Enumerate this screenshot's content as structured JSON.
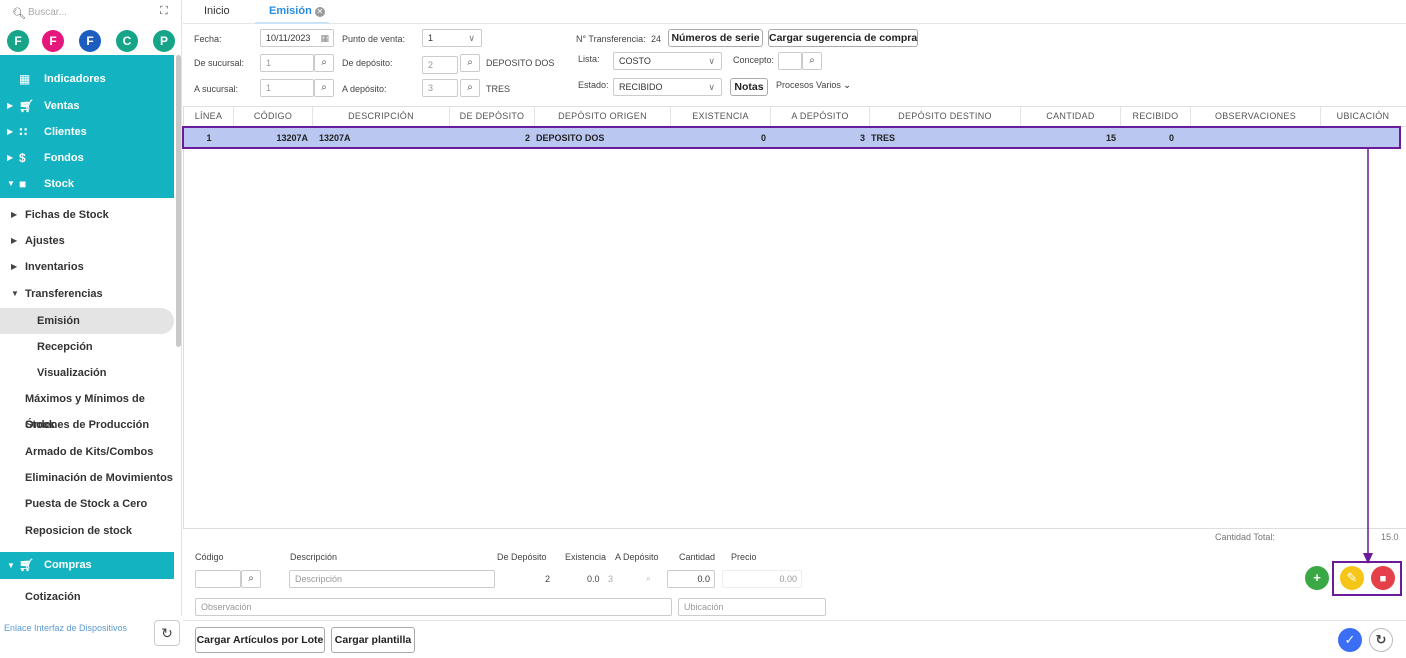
{
  "sidebar": {
    "search_placeholder": "Buscar...",
    "favorites": [
      {
        "letter": "F",
        "color": "#17a589"
      },
      {
        "letter": "F",
        "color": "#e5177d"
      },
      {
        "letter": "F",
        "color": "#1c5dbf"
      },
      {
        "letter": "C",
        "color": "#17a589"
      },
      {
        "letter": "P",
        "color": "#17a589"
      }
    ],
    "items": {
      "indicadores": "Indicadores",
      "ventas": "Ventas",
      "clientes": "Clientes",
      "fondos": "Fondos",
      "stock": "Stock",
      "fichas": "Fichas de Stock",
      "ajustes": "Ajustes",
      "inventarios": "Inventarios",
      "transferencias": "Transferencias",
      "emision": "Emisión",
      "recepcion": "Recepción",
      "visualizacion": "Visualización",
      "maximos": "Máximos y Mínimos de Stock",
      "ordenes": "Órdenes de Producción",
      "armado": "Armado de Kits/Combos",
      "eliminacion": "Eliminación de Movimientos",
      "puesta": "Puesta de Stock a Cero",
      "reposicion": "Reposicion de stock",
      "compras": "Compras",
      "cotizacion": "Cotización"
    },
    "footer_link": "Enlace Interfaz de Dispositivos",
    "accent_color": "#14b3c2"
  },
  "tabs": {
    "inicio": "Inicio",
    "emision": "Emisión"
  },
  "form": {
    "fecha_label": "Fecha:",
    "fecha_value": "10/11/2023",
    "punto_venta_label": "Punto de venta:",
    "punto_venta_value": "1",
    "nro_transferencia_label": "N° Transferencia:",
    "nro_transferencia_value": "24",
    "numeros_serie_btn": "Números de serie",
    "cargar_sugerencia_btn": "Cargar sugerencia de compra",
    "de_sucursal_label": "De sucursal:",
    "de_sucursal_value": "1",
    "de_deposito_label": "De depósito:",
    "de_deposito_value": "2",
    "de_deposito_name": "DEPOSITO DOS",
    "lista_label": "Lista:",
    "lista_value": "COSTO",
    "concepto_label": "Concepto:",
    "a_sucursal_label": "A sucursal:",
    "a_sucursal_value": "1",
    "a_deposito_label": "A depósito:",
    "a_deposito_value": "3",
    "a_deposito_name": "TRES",
    "estado_label": "Estado:",
    "estado_value": "RECIBIDO",
    "notas_btn": "Notas",
    "procesos_varios": "Procesos Varios"
  },
  "table": {
    "columns": [
      "LÍNEA",
      "CÓDIGO",
      "DESCRIPCIÓN",
      "DE DEPÓSITO",
      "DEPÓSITO ORIGEN",
      "EXISTENCIA",
      "A DEPÓSITO",
      "DEPÓSITO DESTINO",
      "CANTIDAD",
      "RECIBIDO",
      "OBSERVACIONES",
      "UBICACIÓN"
    ],
    "rows": [
      {
        "linea": "1",
        "codigo": "13207A",
        "descripcion": "13207A",
        "de_deposito": "2",
        "deposito_origen": "DEPOSITO DOS",
        "existencia": "0",
        "a_deposito": "3",
        "deposito_destino": "TRES",
        "cantidad": "15",
        "recibido": "0",
        "observaciones": "",
        "ubicacion": ""
      }
    ]
  },
  "totals": {
    "cantidad_total_label": "Cantidad Total:",
    "cantidad_total_value": "15.0"
  },
  "entry": {
    "codigo_label": "Código",
    "descripcion_label": "Descripción",
    "de_deposito_label": "De Depósito",
    "existencia_label": "Existencia",
    "a_deposito_label": "A Depósito",
    "cantidad_label": "Cantidad",
    "precio_label": "Precio",
    "descripcion_placeholder": "Descripción",
    "de_deposito_value": "2",
    "existencia_value": "0.0",
    "a_deposito_value": "3",
    "cantidad_value": "0.0",
    "precio_value": "0.00",
    "observacion_placeholder": "Observación",
    "ubicacion_placeholder": "Ubicación"
  },
  "actions": {
    "cargar_lote_btn": "Cargar Artículos por Lote",
    "cargar_plantilla_btn": "Cargar plantilla",
    "add_color": "#3aa845",
    "edit_color": "#f5c518",
    "delete_color": "#e5404a",
    "confirm_color": "#3b6ef5",
    "highlight_color": "#6a1b9a"
  }
}
